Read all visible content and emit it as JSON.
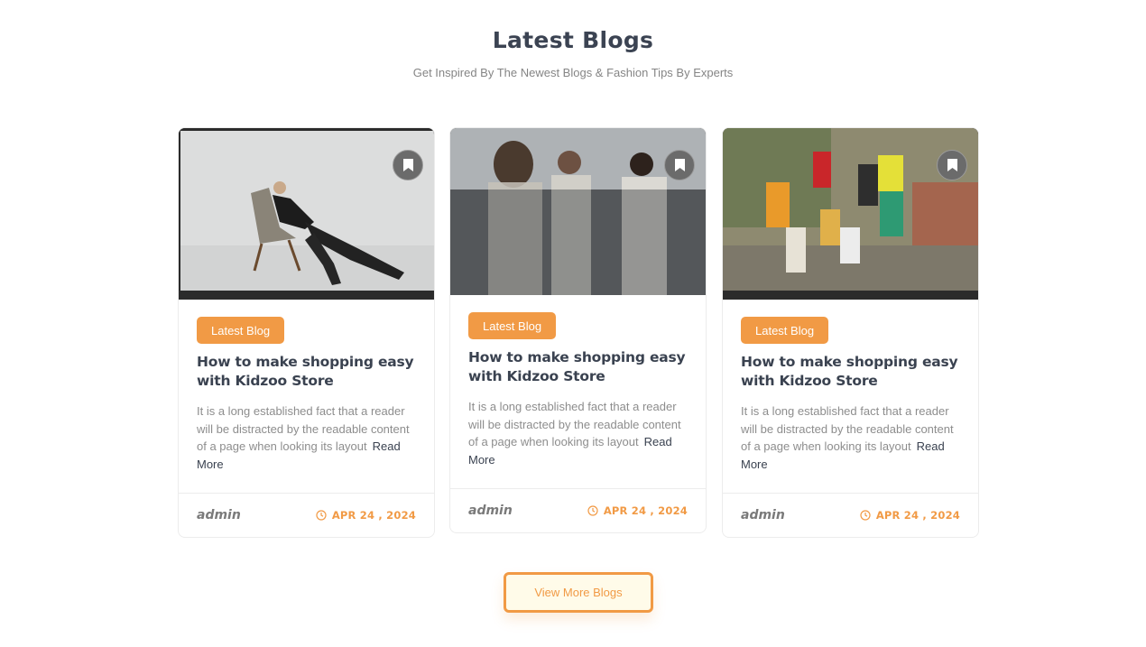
{
  "section": {
    "title": "Latest Blogs",
    "subtitle": "Get Inspired By The Newest Blogs & Fashion Tips By Experts"
  },
  "posts": [
    {
      "category": "Latest Blog",
      "title": "How to make shopping easy with Kidzoo Store",
      "excerpt": "It is a long established fact that a reader will be distracted by the readable content of a page when looking its layout",
      "read_more": "Read More",
      "author": "admin",
      "date": "APR 24 , 2024",
      "image_icon": "woman-in-chair-photo"
    },
    {
      "category": "Latest Blog",
      "title": "How to make shopping easy with Kidzoo Store",
      "excerpt": "It is a long established fact that a reader will be distracted by the readable content of a page when looking its layout",
      "read_more": "Read More",
      "author": "admin",
      "date": "APR 24 , 2024",
      "image_icon": "three-models-photo"
    },
    {
      "category": "Latest Blog",
      "title": "How to make shopping easy with Kidzoo Store",
      "excerpt": "It is a long established fact that a reader will be distracted by the readable content of a page when looking its layout",
      "read_more": "Read More",
      "author": "admin",
      "date": "APR 24 , 2024",
      "image_icon": "group-street-photo"
    }
  ],
  "icons": {
    "bookmark": "bookmark-icon",
    "clock": "clock-icon"
  },
  "colors": {
    "accent": "#f19a45",
    "title": "#3b4352",
    "muted": "#8d8d8d"
  },
  "cta": {
    "label": "View More Blogs"
  }
}
